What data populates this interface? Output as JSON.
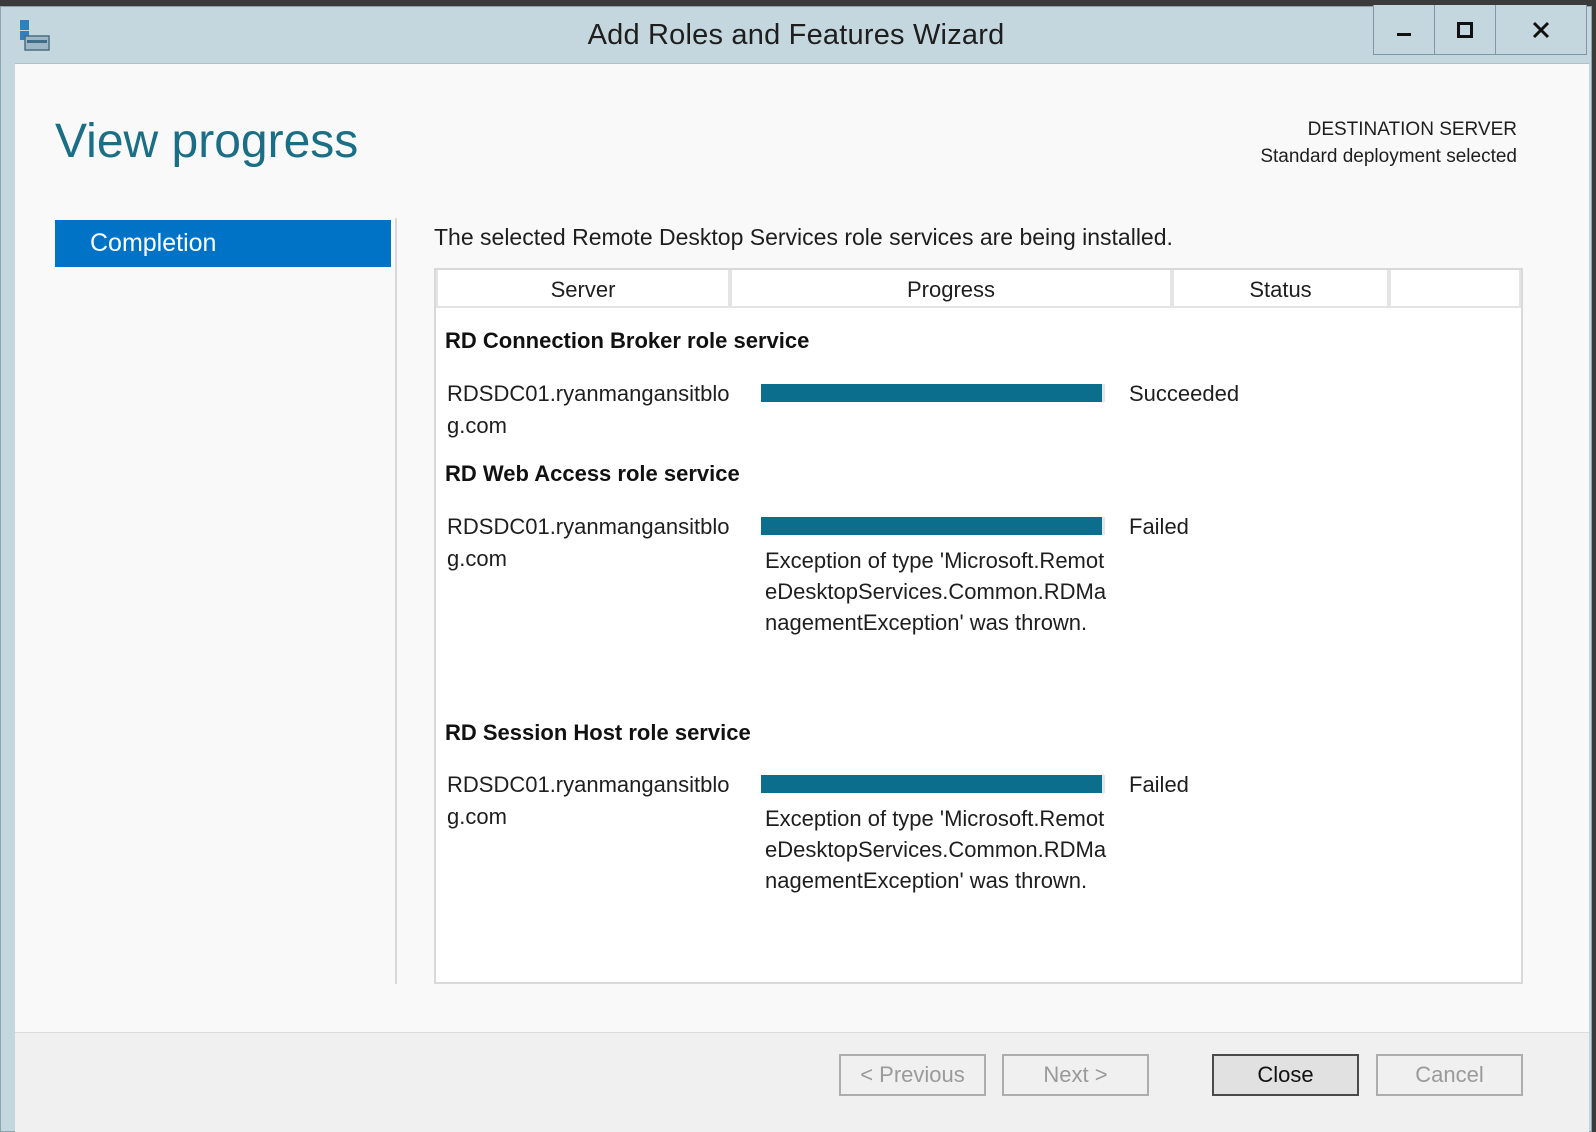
{
  "window": {
    "title": "Add Roles and Features Wizard",
    "icon": "server-manager-icon",
    "controls": {
      "minimize": "minimize-icon",
      "maximize": "maximize-icon",
      "close": "close-icon"
    }
  },
  "page": {
    "heading": "View progress",
    "destination_label": "DESTINATION SERVER",
    "destination_value": "Standard deployment selected"
  },
  "sidebar": {
    "items": [
      {
        "label": "Completion",
        "selected": true
      }
    ]
  },
  "main": {
    "intro": "The selected Remote Desktop Services role services are being installed.",
    "columns": [
      "Server",
      "Progress",
      "Status",
      ""
    ],
    "groups": [
      {
        "title": "RD Connection Broker role service",
        "server": "RDSDC01.ryanmangansitblog.com",
        "progress": 0.99,
        "status": "Succeeded",
        "message": ""
      },
      {
        "title": "RD Web Access role service",
        "server": "RDSDC01.ryanmangansitblog.com",
        "progress": 0.99,
        "status": "Failed",
        "message": "Exception of type 'Microsoft.RemoteDesktopServices.Common.RDManagementException' was thrown."
      },
      {
        "title": "RD Session Host role service",
        "server": "RDSDC01.ryanmangansitblog.com",
        "progress": 0.99,
        "status": "Failed",
        "message": "Exception of type 'Microsoft.RemoteDesktopServices.Common.RDManagementException' was thrown."
      }
    ]
  },
  "footer": {
    "previous": "< Previous",
    "next": "Next >",
    "close": "Close",
    "cancel": "Cancel"
  },
  "colors": {
    "accent": "#0173c7",
    "heading": "#1a6e86",
    "progress": "#0a6e8c",
    "titlebar": "#c5d7de"
  }
}
